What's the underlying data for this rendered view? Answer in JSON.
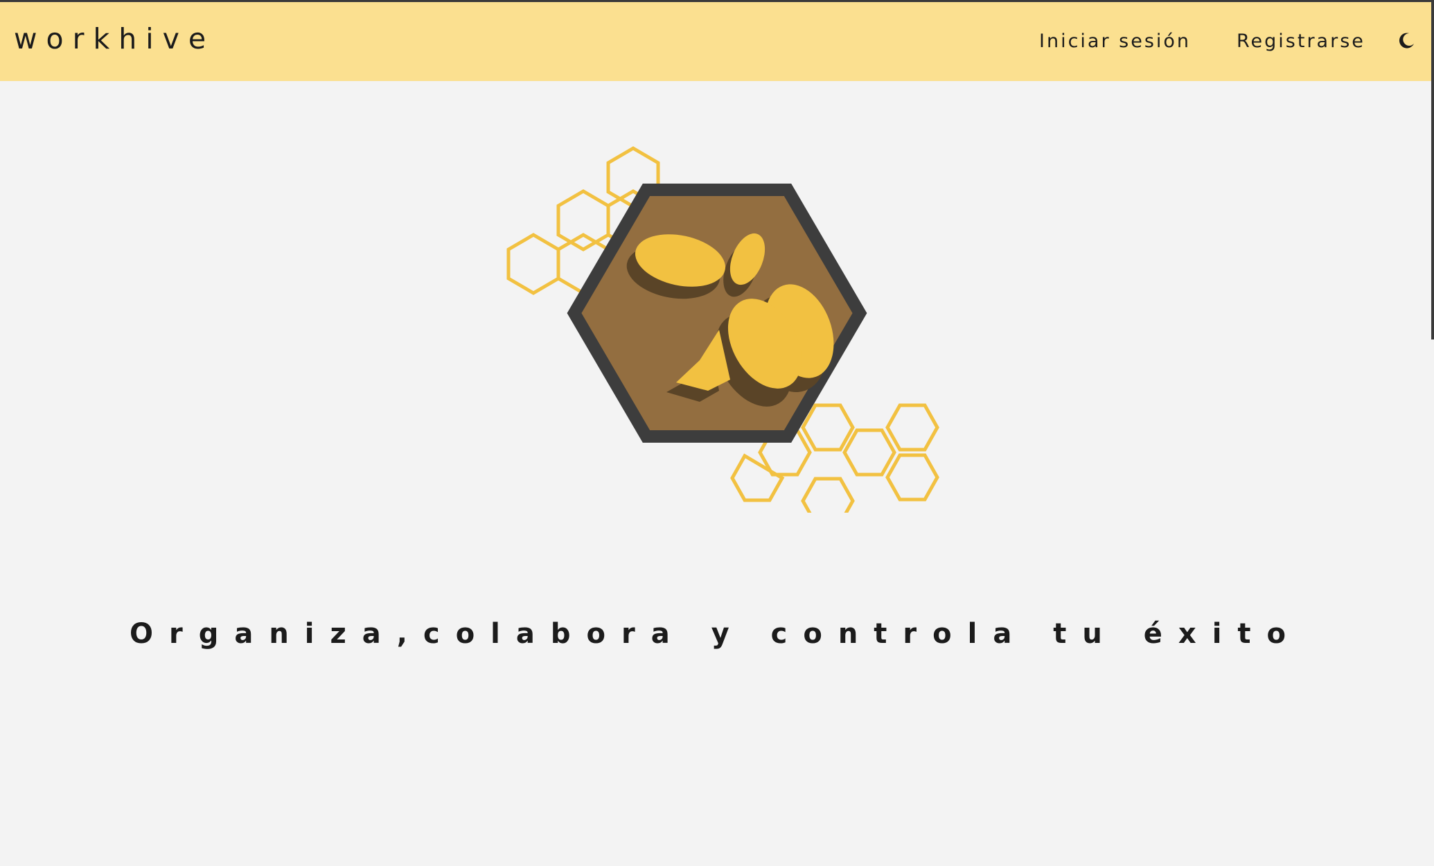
{
  "header": {
    "brand": "workhive",
    "nav": {
      "login_label": "Iniciar sesión",
      "register_label": "Registrarse"
    },
    "theme_toggle_icon": "moon-icon"
  },
  "hero": {
    "logo_icon": "bee-hexagon-logo",
    "decor_icon": "honeycomb-icon",
    "tagline": "Organiza,colabora y controla tu éxito"
  },
  "colors": {
    "navbar_bg": "#fbe090",
    "page_bg": "#f3f3f3",
    "text": "#1b1b1b",
    "honey": "#f2c141",
    "hex_fill": "#936e40",
    "hex_border": "#3d3d3d"
  }
}
